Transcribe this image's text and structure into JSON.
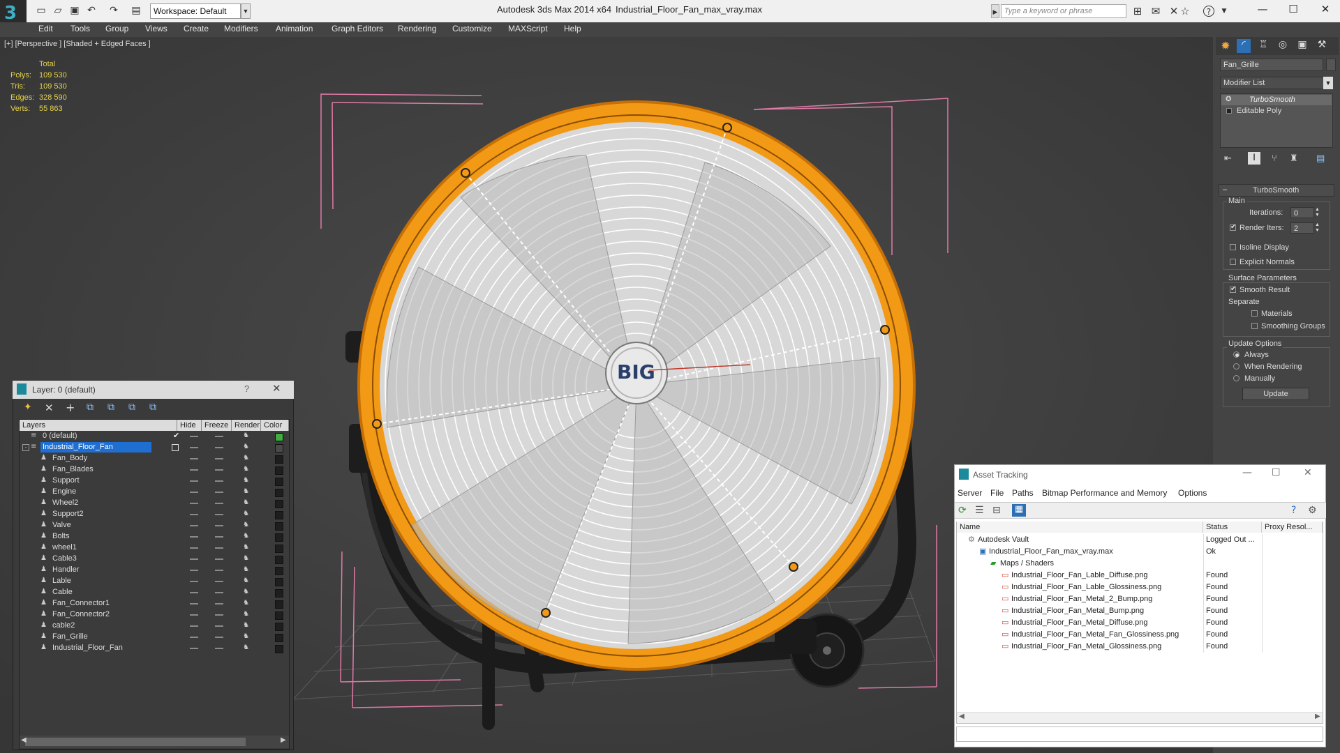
{
  "titlebar": {
    "workspace": "Workspace: Default",
    "app_title": "Autodesk 3ds Max  2014 x64",
    "file_title": "Industrial_Floor_Fan_max_vray.max",
    "search_placeholder": "Type a keyword or phrase"
  },
  "menu": [
    "Edit",
    "Tools",
    "Group",
    "Views",
    "Create",
    "Modifiers",
    "Animation",
    "Graph Editors",
    "Rendering",
    "Customize",
    "MAXScript",
    "Help"
  ],
  "viewport": {
    "label": "[+] [Perspective ] [Shaded + Edged Faces ]",
    "stats": {
      "header": "Total",
      "rows": [
        {
          "label": "Polys:",
          "value": "109 530"
        },
        {
          "label": "Tris:",
          "value": "109 530"
        },
        {
          "label": "Edges:",
          "value": "328 590"
        },
        {
          "label": "Verts:",
          "value": "55 863"
        }
      ]
    },
    "fan_logo": "BIG"
  },
  "command_panel": {
    "object_name": "Fan_Grille",
    "modifier_list": "Modifier List",
    "stack": [
      "TurboSmooth",
      "Editable Poly"
    ],
    "rollout_title": "TurboSmooth",
    "main_label": "Main",
    "iterations_label": "Iterations:",
    "iterations_value": "0",
    "render_iters_label": "Render Iters:",
    "render_iters_value": "2",
    "isoline_display": "Isoline Display",
    "explicit_normals": "Explicit Normals",
    "surface_parameters": "Surface Parameters",
    "smooth_result": "Smooth Result",
    "separate": "Separate",
    "materials": "Materials",
    "smoothing_groups": "Smoothing Groups",
    "update_options": "Update Options",
    "always": "Always",
    "when_rendering": "When Rendering",
    "manually": "Manually",
    "update_button": "Update"
  },
  "layer_window": {
    "title": "Layer: 0 (default)",
    "help": "?",
    "columns": [
      "Layers",
      "Hide",
      "Freeze",
      "Render",
      "Color"
    ],
    "layers": [
      {
        "name": "0 (default)",
        "level": 0,
        "color": "#3fae3f",
        "selected": false
      },
      {
        "name": "Industrial_Floor_Fan",
        "level": 0,
        "color": "#4a4a4a",
        "selected": true
      },
      {
        "name": "Fan_Body",
        "level": 1,
        "color": "#1e1e1e",
        "selected": false
      },
      {
        "name": "Fan_Blades",
        "level": 1,
        "color": "#1e1e1e",
        "selected": false
      },
      {
        "name": "Support",
        "level": 1,
        "color": "#1e1e1e",
        "selected": false
      },
      {
        "name": "Engine",
        "level": 1,
        "color": "#1e1e1e",
        "selected": false
      },
      {
        "name": "Wheel2",
        "level": 1,
        "color": "#1e1e1e",
        "selected": false
      },
      {
        "name": "Support2",
        "level": 1,
        "color": "#1e1e1e",
        "selected": false
      },
      {
        "name": "Valve",
        "level": 1,
        "color": "#1e1e1e",
        "selected": false
      },
      {
        "name": "Bolts",
        "level": 1,
        "color": "#1e1e1e",
        "selected": false
      },
      {
        "name": "wheel1",
        "level": 1,
        "color": "#1e1e1e",
        "selected": false
      },
      {
        "name": "Cable3",
        "level": 1,
        "color": "#1e1e1e",
        "selected": false
      },
      {
        "name": "Handler",
        "level": 1,
        "color": "#1e1e1e",
        "selected": false
      },
      {
        "name": "Lable",
        "level": 1,
        "color": "#1e1e1e",
        "selected": false
      },
      {
        "name": "Cable",
        "level": 1,
        "color": "#1e1e1e",
        "selected": false
      },
      {
        "name": "Fan_Connector1",
        "level": 1,
        "color": "#1e1e1e",
        "selected": false
      },
      {
        "name": "Fan_Connector2",
        "level": 1,
        "color": "#1e1e1e",
        "selected": false
      },
      {
        "name": "cable2",
        "level": 1,
        "color": "#1e1e1e",
        "selected": false
      },
      {
        "name": "Fan_Grille",
        "level": 1,
        "color": "#1e1e1e",
        "selected": false
      },
      {
        "name": "Industrial_Floor_Fan",
        "level": 1,
        "color": "#1e1e1e",
        "selected": false
      }
    ]
  },
  "asset_tracking": {
    "title": "Asset Tracking",
    "menu": [
      "Server",
      "File",
      "Paths",
      "Bitmap Performance and Memory",
      "Options"
    ],
    "columns": [
      "Name",
      "Status",
      "Proxy Resol..."
    ],
    "rows": [
      {
        "name": "Autodesk Vault",
        "status": "Logged Out ...",
        "indent": 0,
        "icon": "vault"
      },
      {
        "name": "Industrial_Floor_Fan_max_vray.max",
        "status": "Ok",
        "indent": 1,
        "icon": "max"
      },
      {
        "name": "Maps / Shaders",
        "status": "",
        "indent": 2,
        "icon": "maps"
      },
      {
        "name": "Industrial_Floor_Fan_Lable_Diffuse.png",
        "status": "Found",
        "indent": 3,
        "icon": "png"
      },
      {
        "name": "Industrial_Floor_Fan_Lable_Glossiness.png",
        "status": "Found",
        "indent": 3,
        "icon": "png"
      },
      {
        "name": "Industrial_Floor_Fan_Metal_2_Bump.png",
        "status": "Found",
        "indent": 3,
        "icon": "png"
      },
      {
        "name": "Industrial_Floor_Fan_Metal_Bump.png",
        "status": "Found",
        "indent": 3,
        "icon": "png"
      },
      {
        "name": "Industrial_Floor_Fan_Metal_Diffuse.png",
        "status": "Found",
        "indent": 3,
        "icon": "png"
      },
      {
        "name": "Industrial_Floor_Fan_Metal_Fan_Glossiness.png",
        "status": "Found",
        "indent": 3,
        "icon": "png"
      },
      {
        "name": "Industrial_Floor_Fan_Metal_Glossiness.png",
        "status": "Found",
        "indent": 3,
        "icon": "png"
      }
    ]
  },
  "colors": {
    "fan_orange": "#f29a16",
    "selection_blue": "#1e6fd1",
    "viewport_bg": "#3f3f3f",
    "stats_yellow": "#e6d24a",
    "bbox_pink": "#e07aa8"
  }
}
